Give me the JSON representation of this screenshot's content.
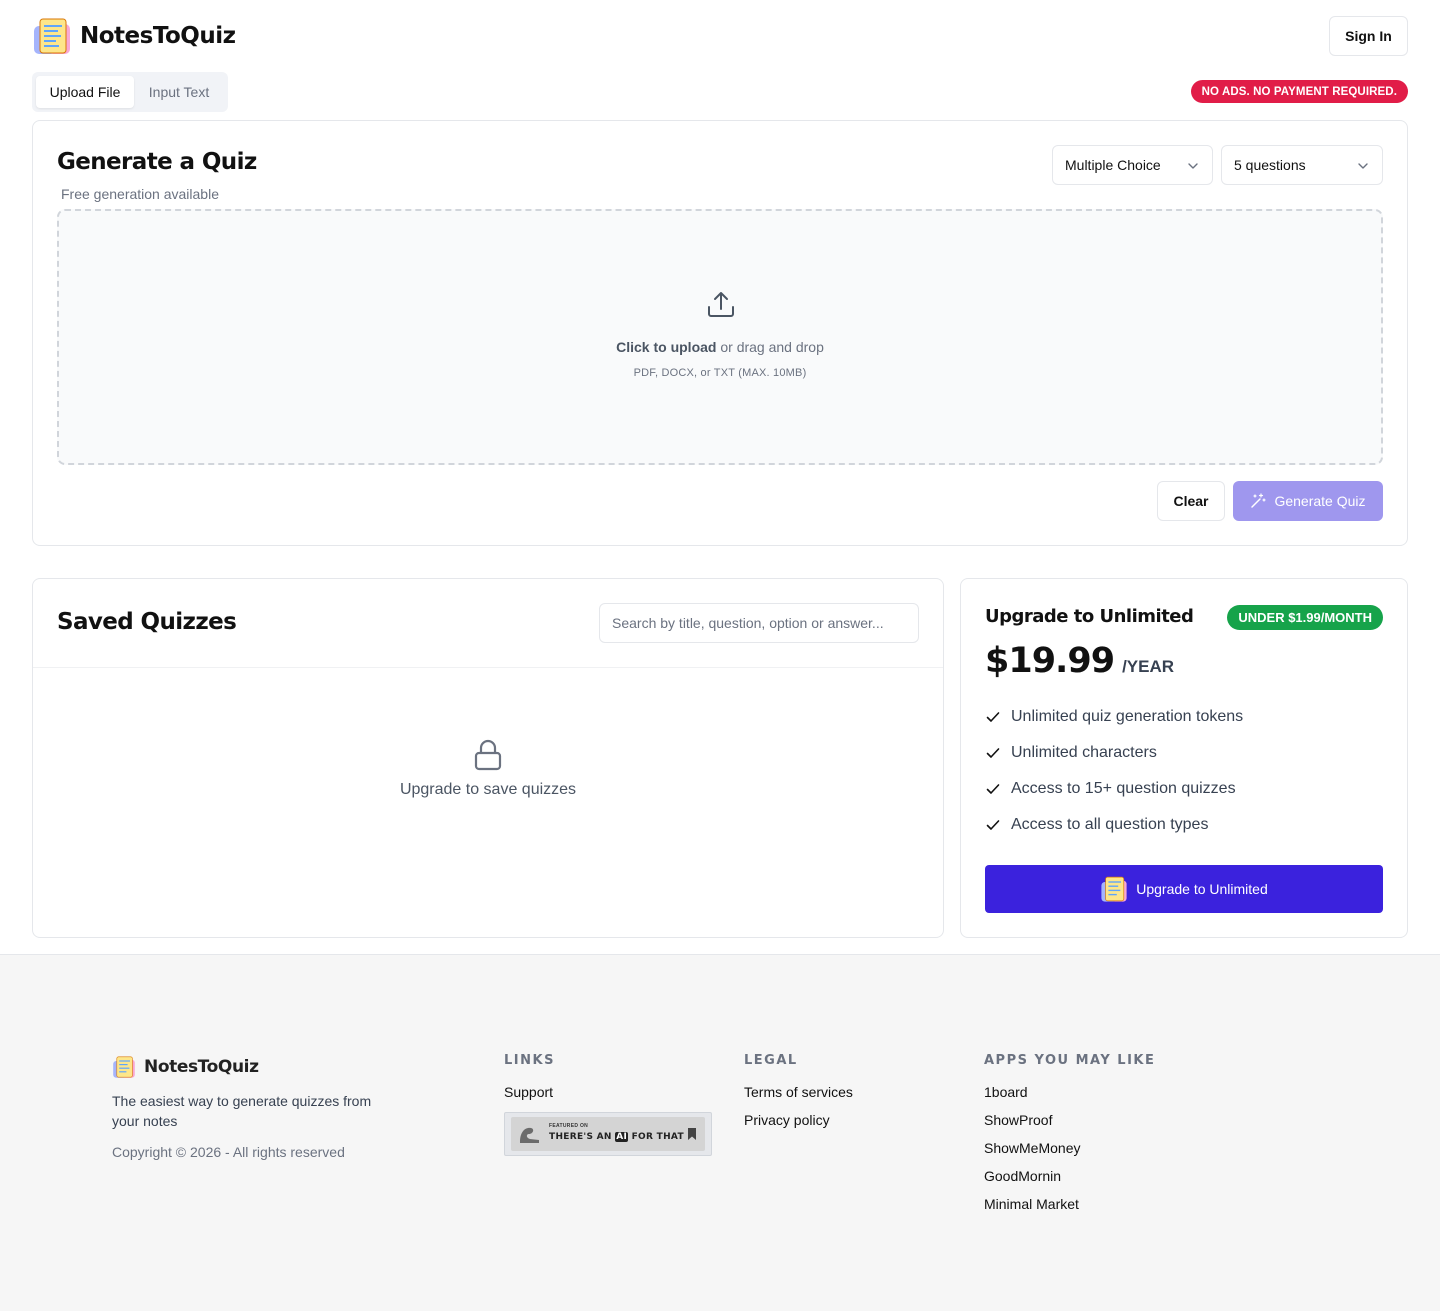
{
  "header": {
    "brand_name": "NotesToQuiz",
    "signin_label": "Sign In"
  },
  "tabs": [
    {
      "label": "Upload File",
      "active": true
    },
    {
      "label": "Input Text",
      "active": false
    }
  ],
  "notice_badge": "NO ADS. NO PAYMENT REQUIRED.",
  "generator": {
    "title": "Generate a Quiz",
    "subtitle": "Free generation available",
    "type_select": "Multiple Choice",
    "count_select": "5 questions",
    "upload_strong": "Click to upload",
    "upload_rest": " or drag and drop",
    "upload_hint": "PDF, DOCX, or TXT (MAX. 10MB)",
    "clear_label": "Clear",
    "generate_label": "Generate Quiz"
  },
  "saved": {
    "title": "Saved Quizzes",
    "search_placeholder": "Search by title, question, option or answer...",
    "empty_message": "Upgrade to save quizzes"
  },
  "upgrade": {
    "title": "Upgrade to Unlimited",
    "badge": "UNDER $1.99/MONTH",
    "price": "$19.99",
    "period": "/YEAR",
    "features": [
      "Unlimited quiz generation tokens",
      "Unlimited characters",
      "Access to 15+ question quizzes",
      "Access to all question types"
    ],
    "button_label": "Upgrade to Unlimited"
  },
  "footer": {
    "brand_name": "NotesToQuiz",
    "tagline": "The easiest way to generate quizzes from your notes",
    "copyright": "Copyright © 2026 - All rights reserved",
    "links_heading": "LINKS",
    "links": [
      "Support"
    ],
    "featured_small": "FEATURED ON",
    "featured_big_pre": "THERE'S AN",
    "featured_big_ai": "AI",
    "featured_big_post": "FOR THAT",
    "legal_heading": "LEGAL",
    "legal": [
      "Terms of services",
      "Privacy policy"
    ],
    "apps_heading": "APPS YOU MAY LIKE",
    "apps": [
      "1board",
      "ShowProof",
      "ShowMeMoney",
      "GoodMornin",
      "Minimal Market"
    ]
  },
  "colors": {
    "accent": "#3b22dd",
    "accent_disabled": "#9f97ee",
    "notice_red": "#e11d48",
    "price_green": "#16a34a"
  },
  "icons": [
    "app-logo-icon",
    "chevron-down-icon",
    "upload-icon",
    "magic-wand-icon",
    "lock-icon",
    "check-icon"
  ]
}
